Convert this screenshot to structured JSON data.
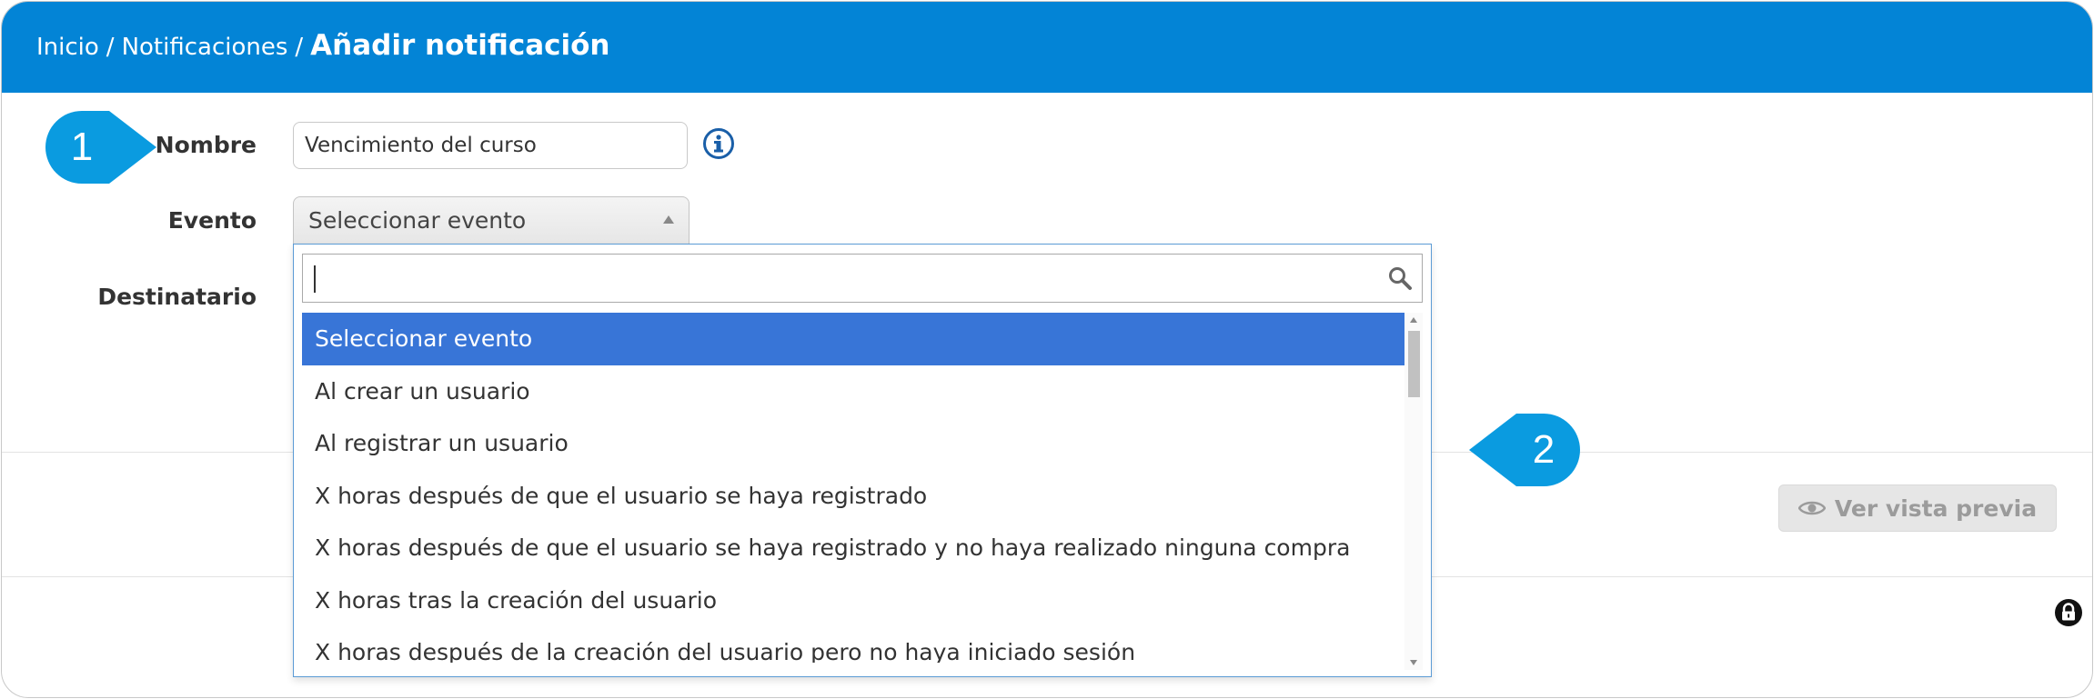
{
  "breadcrumb": {
    "items": [
      "Inicio",
      "Notificaciones"
    ],
    "separator": "/",
    "current": "Añadir notificación"
  },
  "form": {
    "name_label": "Nombre",
    "name_value": "Vencimiento del curso",
    "event_label": "Evento",
    "event_selected": "Seleccionar evento",
    "recipient_label": "Destinatario"
  },
  "dropdown": {
    "search_value": "",
    "options": [
      "Seleccionar evento",
      "Al crear un usuario",
      "Al registrar un usuario",
      "X horas después de que el usuario se haya registrado",
      "X horas después de que el usuario se haya registrado y no haya realizado ninguna compra",
      "X horas tras la creación del usuario",
      "X horas después de la creación del usuario pero no haya iniciado sesión"
    ],
    "highlighted_index": 0
  },
  "actions": {
    "preview_label": "Ver vista previa"
  },
  "callouts": {
    "first": "1",
    "second": "2"
  },
  "colors": {
    "header": "#0384d6",
    "highlight": "#3875d7",
    "callout": "#0a9be0",
    "info_icon": "#1a5fa8"
  },
  "icons": {
    "info": "info-icon",
    "search": "search-icon",
    "eye": "eye-icon",
    "lock": "lock-icon"
  }
}
